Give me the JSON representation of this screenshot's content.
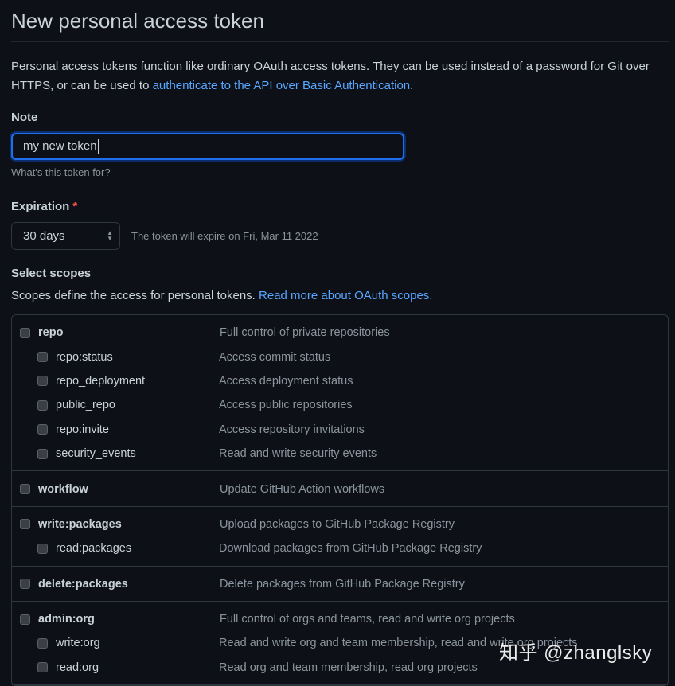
{
  "title": "New personal access token",
  "intro": {
    "text": "Personal access tokens function like ordinary OAuth access tokens. They can be used instead of a password for Git over HTTPS, or can be used to ",
    "link": "authenticate to the API over Basic Authentication",
    "end": "."
  },
  "note": {
    "label": "Note",
    "value": "my new token",
    "help": "What's this token for?"
  },
  "expiration": {
    "label": "Expiration",
    "required": "*",
    "value": "30 days",
    "info": "The token will expire on Fri, Mar 11 2022"
  },
  "scopes": {
    "label": "Select scopes",
    "desc": "Scopes define the access for personal tokens. ",
    "link": "Read more about OAuth scopes.",
    "groups": [
      {
        "items": [
          {
            "name": "repo",
            "desc": "Full control of private repositories"
          },
          {
            "name": "repo:status",
            "desc": "Access commit status"
          },
          {
            "name": "repo_deployment",
            "desc": "Access deployment status"
          },
          {
            "name": "public_repo",
            "desc": "Access public repositories"
          },
          {
            "name": "repo:invite",
            "desc": "Access repository invitations"
          },
          {
            "name": "security_events",
            "desc": "Read and write security events"
          }
        ]
      },
      {
        "items": [
          {
            "name": "workflow",
            "desc": "Update GitHub Action workflows"
          }
        ]
      },
      {
        "items": [
          {
            "name": "write:packages",
            "desc": "Upload packages to GitHub Package Registry"
          },
          {
            "name": "read:packages",
            "desc": "Download packages from GitHub Package Registry"
          }
        ]
      },
      {
        "items": [
          {
            "name": "delete:packages",
            "desc": "Delete packages from GitHub Package Registry"
          }
        ]
      },
      {
        "items": [
          {
            "name": "admin:org",
            "desc": "Full control of orgs and teams, read and write org projects"
          },
          {
            "name": "write:org",
            "desc": "Read and write org and team membership, read and write org projects"
          },
          {
            "name": "read:org",
            "desc": "Read org and team membership, read org projects"
          }
        ]
      }
    ]
  },
  "watermark": "知乎 @zhanglsky"
}
